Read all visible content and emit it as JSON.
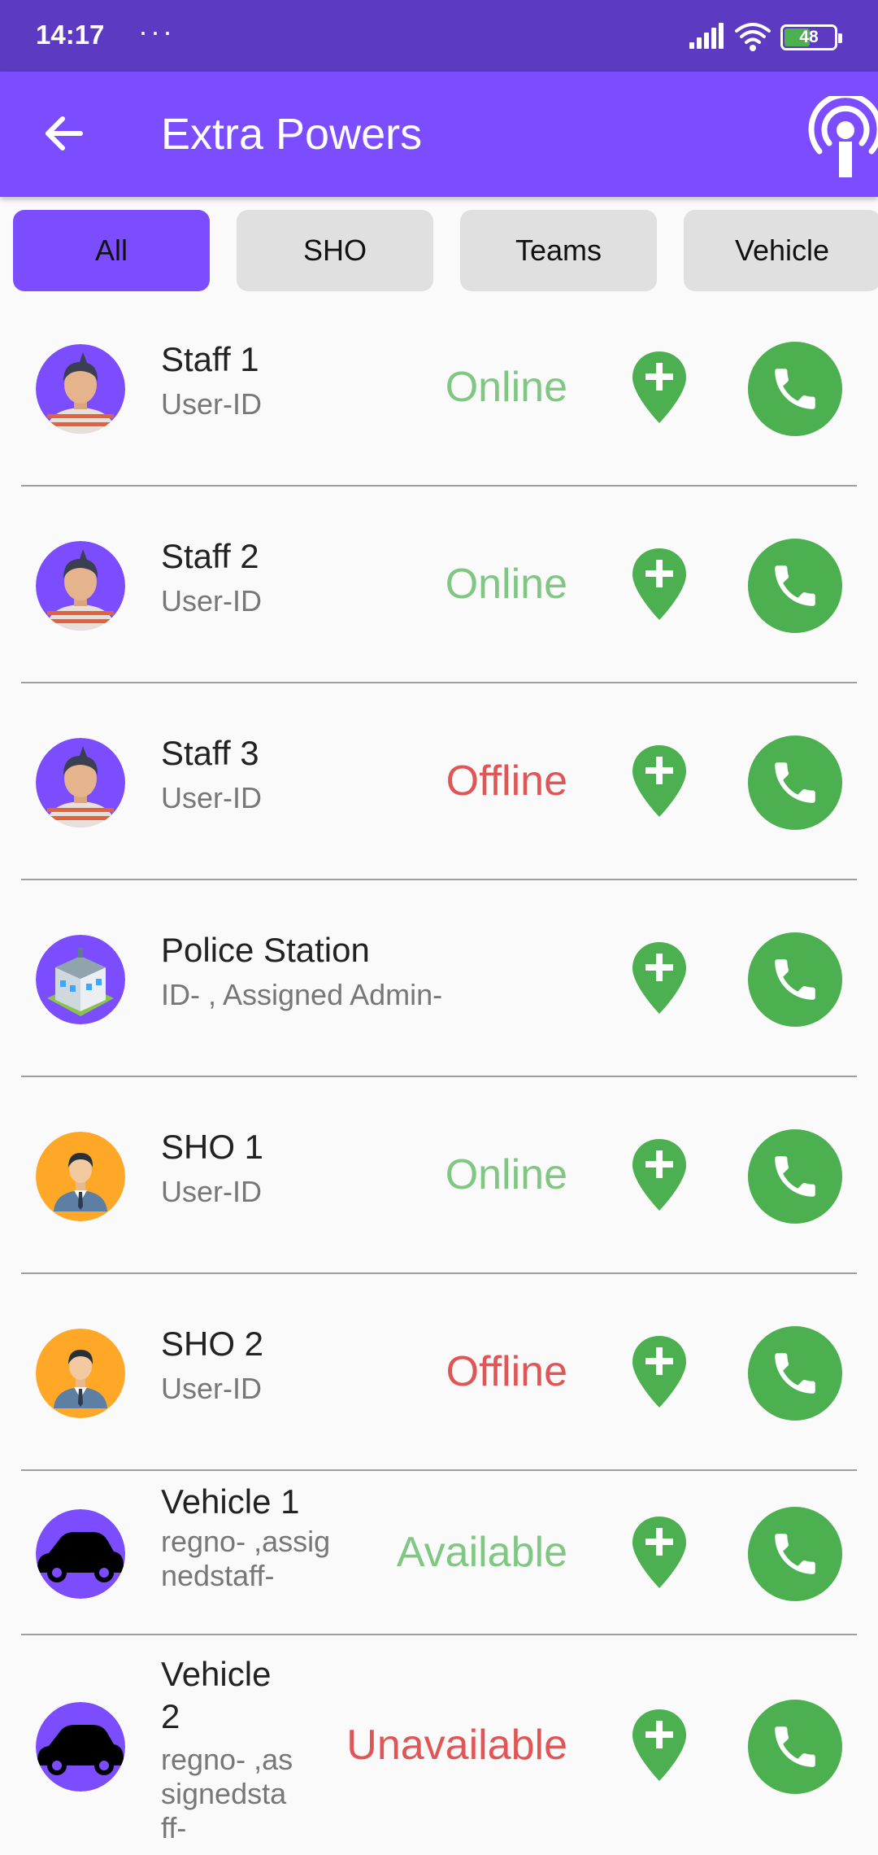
{
  "status_bar": {
    "time": "14:17",
    "dots": "···",
    "battery": "48"
  },
  "app_bar": {
    "title": "Extra Powers"
  },
  "tabs": [
    {
      "label": "All"
    },
    {
      "label": "SHO"
    },
    {
      "label": "Teams"
    },
    {
      "label": "Vehicle"
    }
  ],
  "items": [
    {
      "name": "Staff 1",
      "sub": "User-ID",
      "status": "Online",
      "status_color": "#81c784",
      "avatar": "staff-avatar"
    },
    {
      "name": "Staff 2",
      "sub": "User-ID",
      "status": "Online",
      "status_color": "#81c784",
      "avatar": "staff-avatar"
    },
    {
      "name": "Staff 3",
      "sub": "User-ID",
      "status": "Offline",
      "status_color": "#e05656",
      "avatar": "staff-avatar"
    },
    {
      "name": "Police Station",
      "sub": "ID- , Assigned Admin-",
      "status": "",
      "status_color": "#81c784",
      "avatar": "police-station-avatar"
    },
    {
      "name": "SHO 1",
      "sub": "User-ID",
      "status": "Online",
      "status_color": "#81c784",
      "avatar": "officer-avatar"
    },
    {
      "name": "SHO 2",
      "sub": "User-ID",
      "status": "Offline",
      "status_color": "#e05656",
      "avatar": "officer-avatar"
    },
    {
      "name": "Vehicle 1",
      "sub": "regno- ,assig\nnedstaff-",
      "status": "Available",
      "status_color": "#81c784",
      "avatar": "car-avatar"
    },
    {
      "name": "Vehicle\n2",
      "sub": "regno- ,as\nsignedsta\nff-",
      "status": "Unavailable",
      "status_color": "#e05656",
      "avatar": "car-avatar"
    }
  ],
  "colors": {
    "status_bar": "#5c3bc2",
    "app_bar": "#7c4dff",
    "call_button": "#4caf50",
    "online": "#81c784",
    "offline": "#e05656"
  }
}
